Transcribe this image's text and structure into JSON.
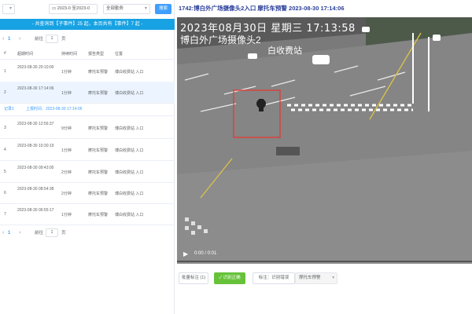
{
  "filters": {
    "date_range": "2023-0 至2023-0",
    "scope": "全部勤务",
    "search_label": "搜索"
  },
  "banner": "- 共查询到【子事件】25 起，本页共有【事件】7 起 -",
  "pager": {
    "prev": "‹",
    "next": "›",
    "page": "1",
    "goto_label": "前往",
    "page_input": "1",
    "page_unit": "页"
  },
  "table": {
    "headers": [
      "#",
      "超期时间",
      "持续时间",
      "报告类型",
      "位置"
    ],
    "rows": [
      {
        "index": "1",
        "time": "2023-08-30 20:10:00",
        "duration": "1分钟",
        "type": "摩托车预警",
        "location": "博白收费站 入口"
      },
      {
        "index": "2",
        "time": "2023-08-30 17:14:06",
        "duration": "1分钟",
        "type": "摩托车预警",
        "location": "博白收费站 入口"
      },
      {
        "index": "3",
        "time": "2023-08-30 12:56:37",
        "duration": "9分钟",
        "type": "摩托车预警",
        "location": "博白收费站 入口"
      },
      {
        "index": "4",
        "time": "2023-08-30 10:30:19",
        "duration": "1分钟",
        "type": "摩托车预警",
        "location": "博白收费站 入口"
      },
      {
        "index": "5",
        "time": "2023-08-30 09:43:00",
        "duration": "2分钟",
        "type": "摩托车预警",
        "location": "博白收费站 入口"
      },
      {
        "index": "6",
        "time": "2023-08-30 08:54:38",
        "duration": "2分钟",
        "type": "摩托车预警",
        "location": "博白收费站 入口"
      },
      {
        "index": "7",
        "time": "2023-08-30 06:55:17",
        "duration": "1分钟",
        "type": "摩托车预警",
        "location": "博白收费站 入口"
      }
    ],
    "subrow": {
      "label": "记录1",
      "link": "上报时间：2023-08-30 17:14:06"
    }
  },
  "video": {
    "title": "1742:博白外广场摄像头2入口 摩托车预警 2023-08-30 17:14:06",
    "overlay_date": "2023年08月30日  星期三  17:13:58",
    "overlay_camera": "博白外广场摄像头2",
    "overlay_gate": "白收费站",
    "time_display": "0:00 / 0:01",
    "play_icon": "play-icon"
  },
  "actions": {
    "batch_label": "批量标注 (1)",
    "confirm_label": "✓ 识别正确",
    "tag_label": "标注：识别错误",
    "type_value": "摩托车预警"
  },
  "colors": {
    "accent": "#409eff",
    "banner": "#17a2e3",
    "confirm": "#67c23a",
    "title": "#2a3f9a",
    "highlight_box": "#e53935"
  }
}
